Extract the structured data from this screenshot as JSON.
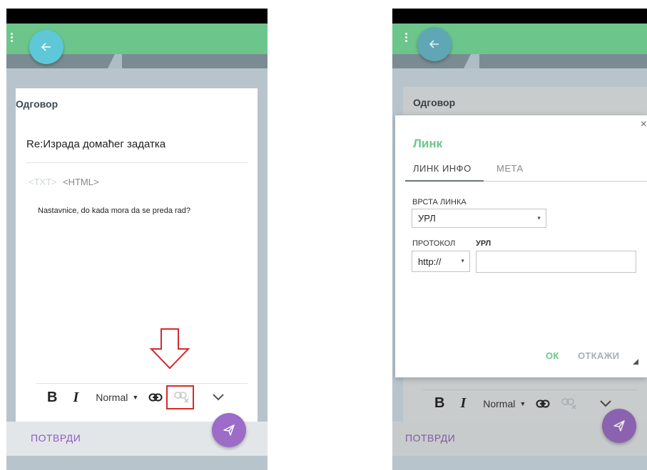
{
  "screens": {
    "left": {
      "card_title": "Одговор",
      "subject": "Re:Израда домаћег задатка",
      "format_txt": "<TXT>",
      "format_html": "<HTML>",
      "body": "Nastavnice, do kada mora da se preda rad?",
      "toolbar": {
        "bold": "B",
        "italic": "I",
        "style": "Normal"
      },
      "confirm_label": "ПОТВРДИ"
    },
    "right": {
      "card_title": "Одговор",
      "toolbar": {
        "bold": "B",
        "italic": "I",
        "style": "Normal"
      },
      "confirm_label": "ПОТВРДИ",
      "dialog": {
        "close": "×",
        "title": "Линк",
        "tabs": [
          "ЛИНК ИНФО",
          "МЕТА"
        ],
        "link_type_label": "ВРСТА ЛИНКА",
        "link_type_value": "УРЛ",
        "protocol_label": "ПРОТОКОЛ",
        "protocol_value": "http://",
        "url_label": "УРЛ",
        "url_value": "",
        "ok": "ОК",
        "cancel": "ОТКАЖИ"
      }
    }
  },
  "colors": {
    "appbar": "#6cc68c",
    "back_fab": "#5ec8d8",
    "send_fab": "#9c6cc8",
    "accent_purple": "#8e5bc4",
    "highlight": "#d62a2a"
  },
  "icons": [
    "menu-dots-icon",
    "back-arrow-icon",
    "link-icon",
    "unlink-icon",
    "chevron-down-icon",
    "send-icon",
    "down-arrow-annotation-icon",
    "resize-handle-icon"
  ]
}
